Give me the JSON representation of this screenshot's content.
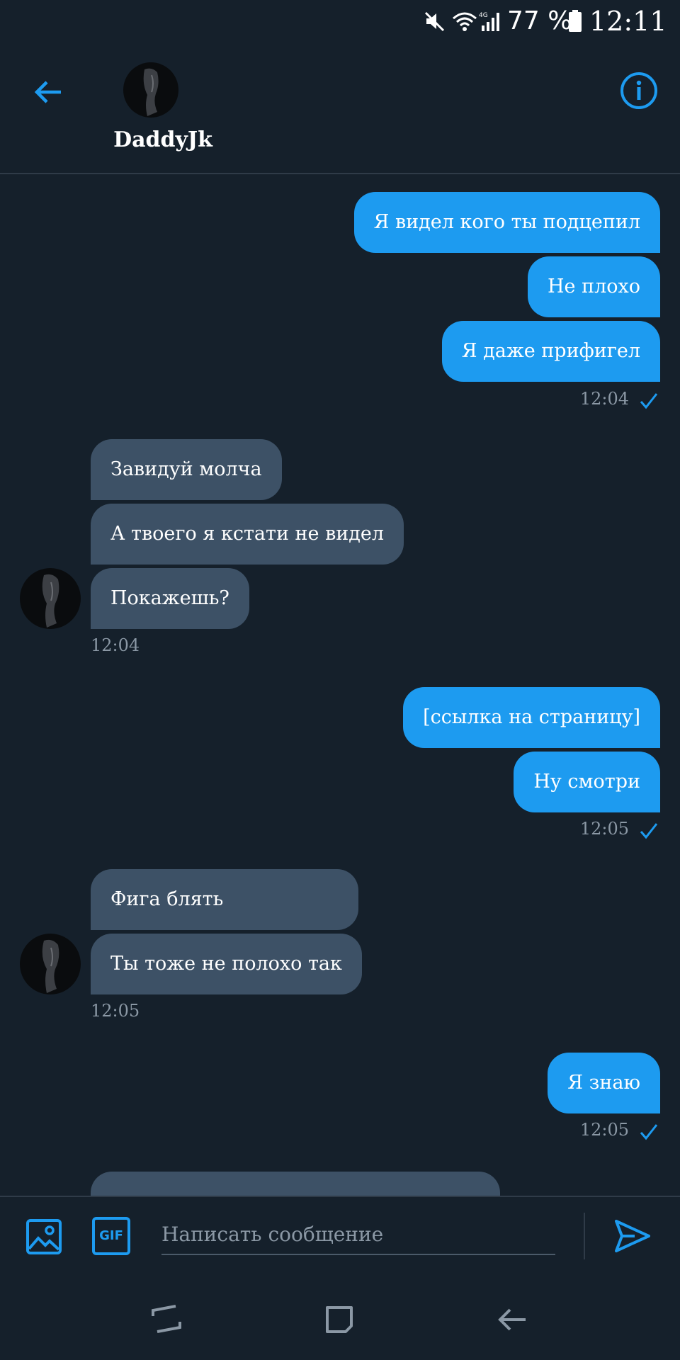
{
  "status_bar": {
    "battery_percent": "77 %",
    "time": "12:11",
    "icons": [
      "mute-icon",
      "wifi-icon",
      "signal-4g-icon",
      "battery-icon"
    ]
  },
  "header": {
    "contact_name": "DaddyJk",
    "back_icon": "arrow-left-icon",
    "info_icon": "info-icon"
  },
  "messages": {
    "g1": {
      "m1": "Я видел кого ты подцепил",
      "m2": "Не плохо",
      "m3": "Я даже прифигел",
      "time": "12:04"
    },
    "g2": {
      "m1": "Завидуй молча",
      "m2": "А твоего я кстати не видел",
      "m3": "Покажешь?",
      "time": "12:04"
    },
    "g3": {
      "m1": "[ссылка на страницу]",
      "m2": "Ну смотри",
      "time": "12:05"
    },
    "g4": {
      "m1": "Фига блять",
      "m2": "Ты тоже не полохо так",
      "time": "12:05"
    },
    "g5": {
      "m1": "Я знаю",
      "time": "12:05"
    }
  },
  "composer": {
    "placeholder": "Написать сообщение",
    "gif_label": "GIF"
  },
  "colors": {
    "background": "#15202b",
    "outgoing_bubble": "#1d9bf0",
    "incoming_bubble": "#3d5166",
    "accent": "#1d9bf0",
    "timestamp": "#8b98a5"
  }
}
